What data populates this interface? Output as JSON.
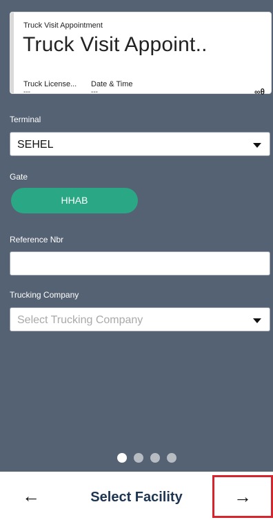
{
  "card": {
    "subtitle": "Truck Visit Appointment",
    "title": "Truck Visit Appoint..",
    "col1_label": "Truck License...",
    "col1_value": "---",
    "col2_label": "Date & Time",
    "col2_value": "---",
    "link_icon_glyph": "∞θ",
    "link_icon_name": "link-icon"
  },
  "form": {
    "terminal_label": "Terminal",
    "terminal_value": "SEHEL",
    "gate_label": "Gate",
    "gate_value": "HHAB",
    "reference_label": "Reference Nbr",
    "reference_value": "",
    "trucking_label": "Trucking Company",
    "trucking_placeholder": "Select Trucking Company"
  },
  "pager": {
    "total": 4,
    "active": 1
  },
  "footer": {
    "back_glyph": "←",
    "title": "Select Facility",
    "next_glyph": "→"
  },
  "colors": {
    "background": "#556273",
    "gate_chip": "#2aa886",
    "footer_title": "#1d3550",
    "highlight_border": "#d6232c"
  }
}
